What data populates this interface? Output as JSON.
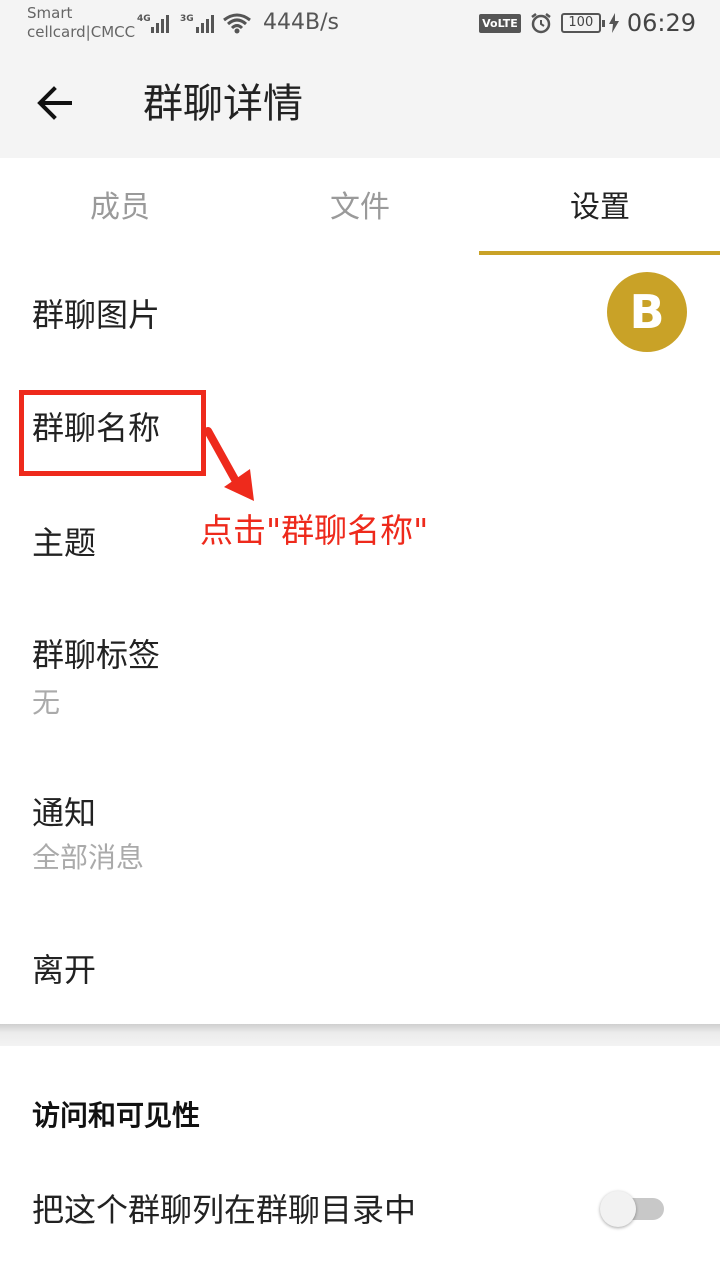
{
  "status_bar": {
    "carrier_line1": "Smart",
    "carrier_line2": "cellcard|CMCC",
    "net1": "4G",
    "net2": "3G",
    "speed": "444B/s",
    "volte": "VoLTE",
    "battery": "100",
    "time": "06:29"
  },
  "app_bar": {
    "back_icon": "arrow-left-icon",
    "title": "群聊详情"
  },
  "tabs": [
    {
      "label": "成员",
      "active": false
    },
    {
      "label": "文件",
      "active": false
    },
    {
      "label": "设置",
      "active": true
    }
  ],
  "settings": {
    "group_image_label": "群聊图片",
    "avatar_letter": "B",
    "group_name_label": "群聊名称",
    "topic_label": "主题",
    "group_tags_label": "群聊标签",
    "group_tags_value": "无",
    "notify_label": "通知",
    "notify_value": "全部消息",
    "leave_label": "离开"
  },
  "annotation": {
    "text": "点击\"群聊名称\""
  },
  "access_section": {
    "title": "访问和可见性",
    "list_in_directory_label": "把这个群聊列在群聊目录中",
    "list_in_directory_on": false
  },
  "colors": {
    "accent": "#c9a227",
    "annotation_red": "#ee2a1c",
    "bar_bg": "#f4f4f4"
  }
}
